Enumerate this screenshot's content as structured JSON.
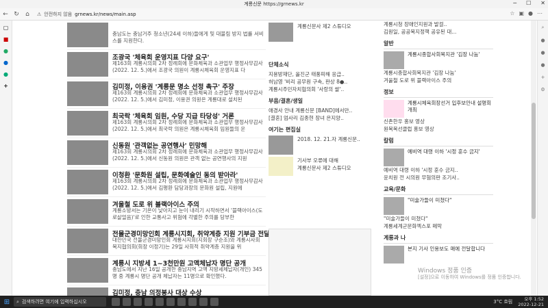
{
  "window": {
    "title": "계룡신문 https://grnews.kr"
  },
  "address": {
    "security": "안전하지 않음",
    "url": "grnews.kr/news/main.asp"
  },
  "main_articles": [
    {
      "title": "",
      "desc": "충남도는 충남거주 청소년(24세 이하)들에게 및 대불림 방지 법률 서비스를 지원한다."
    },
    {
      "title": "조광국 '체육회 운영지표 다양 요구'",
      "desc": "제163회 계룡시의회 2차 정례회에 문화체육과 소관업무 행정사무감사(2022. 12. 5.)에서 조광국 의원이 계룡시체육회 운영지표 다"
    },
    {
      "title": "김미정, 이용권 '계룡문 명소 선정 촉구' 주장",
      "desc": "제163회 계룡시의회 2차 정례회에 문화체육과 소관업무 행정사무감사(2022. 12. 5.)에서 김미정, 이용권 의원은 계룡대로 설치된"
    },
    {
      "title": "최국락 '체육회 임원, 수당 지급 타당성' 거론",
      "desc": "제163회 계룡시의회 2차 정례회에 문화체육과 소관업무 행정사무감사(2022. 12. 5.)에서 최국락 의원은 계룡시체육회 임원들의 운"
    },
    {
      "title": "신동원 '관객없는 공연행사' 민망해",
      "desc": "제163회 계룡시의회 2차 정례회에 문화체육과 소관업무 행정사무감사(2022. 12. 5.)에서 신동원 의원은 관객 없는 공연행사의 지원"
    },
    {
      "title": "이청환 '문화원 설립, 문화예술인 동의 받아라'",
      "desc": "제163회 계룡시의회 2차 정례회에 문화체육과 소관업무 행정사무감사(2022. 12. 5.)에서 김평환 담당과장의 문화원 설립, 지원에"
    },
    {
      "title": "겨울철 도로 위 블랙아이스 주의",
      "desc": "계룡소방서는 기온이 낮아지고 눈이 내리기 시작하면서 '블랙아이스(도로살얼음)'로 인한 교통사고 위험에 각별한 주의를 당부한"
    },
    {
      "title": "전몰군경미망인회 계룡시지회, 취약계층 지원 기부금 전달",
      "desc": "대한민국 전몰군경미망인회 계룡시지회(지회장 구순조)와 계룡시사회복지협의회(회장 이정기)는 29일 사회적 취약계층 지원을 위"
    },
    {
      "title": "계룡시 지방세 1~3천만원 고액체납자 명단 공개",
      "desc": "충남도에서 지난 16일 공개한 충남지역 고액 지방세체납자(개인) 345명 중 계룡시 명단 공개 체납자는 11명으로 확인했다."
    },
    {
      "title": "김미정, 충남 의정봉사 대상 수상",
      "desc": ""
    }
  ],
  "mid": {
    "top_item": "계룡신문사 제2 스튜디오",
    "sec1_title": "단체소식",
    "sec1_items": [
      "지용방재단, 올진군 태풍피해 응급..",
      "허남영 '비리 공무원 구속, 판상 8●..",
      "계룡시주민자치협의회 '사랑의 쌀'.."
    ],
    "sec2_title": "부음/결혼/생일",
    "sec2_items": [
      "애경사 안내 계룡신문 [BAND]에서만..",
      "[결혼] 엄사리 김종현 장녀 은지양.."
    ],
    "sec3_title": "여기는 편집실",
    "sec3_rows": [
      {
        "text": "2018. 12. 21.자 계룡신문.."
      },
      {
        "text": "기사부 오류에 대해"
      },
      {
        "text": "계룡신문사 제2 스튜디오"
      }
    ]
  },
  "right": {
    "top_items": [
      "계룡시청 장애인지원과 발걸..",
      "김원일, 공공목지정책 공유된 대..."
    ],
    "sec1_title": "알반",
    "sec1_box": "계룡시종합사회복지관 '김장 나눔'",
    "sec1_items": [
      "계룡시종합사회복지관 '김장 나눔'",
      "겨울철 도로 위 블랙아이스 주의"
    ],
    "sec2_title": "정보",
    "sec2_box": "계룡시체육회장선거 입후보안내 설명회 개최",
    "sec2_items": [
      "신촌한우 홍보 영상",
      "원목복선클럽 홍보 영상"
    ],
    "sec3_title": "칼럼",
    "sec3_box": "예비역 대령 이하 '시정 훈수 금지'",
    "sec3_items": [
      "예비역 대령 이하 '시정 훈수 금지..",
      "윤치원 전 시의원 무혐의판 조기사.."
    ],
    "sec4_title": "교육/문화",
    "sec4_box": "\"미술가들이 미쳤다\"",
    "sec4_items": [
      "\"미술가들이 미쳤다\"",
      "계룡세계군문화엑스포 페막"
    ],
    "sec5_title": "계룡과 나",
    "sec5_box": "본지 기사 인용보도 매에 전달합니다"
  },
  "watermark": {
    "line1": "Windows 정품 인증",
    "line2": "[설정]으로 이동하여 Windows를 정품 인증합니다."
  },
  "taskbar": {
    "search": "검색하려면 여기에 입력하십시오",
    "weather": "3°C 흐림",
    "time": "오후 1:52",
    "date": "2022-12-21"
  }
}
